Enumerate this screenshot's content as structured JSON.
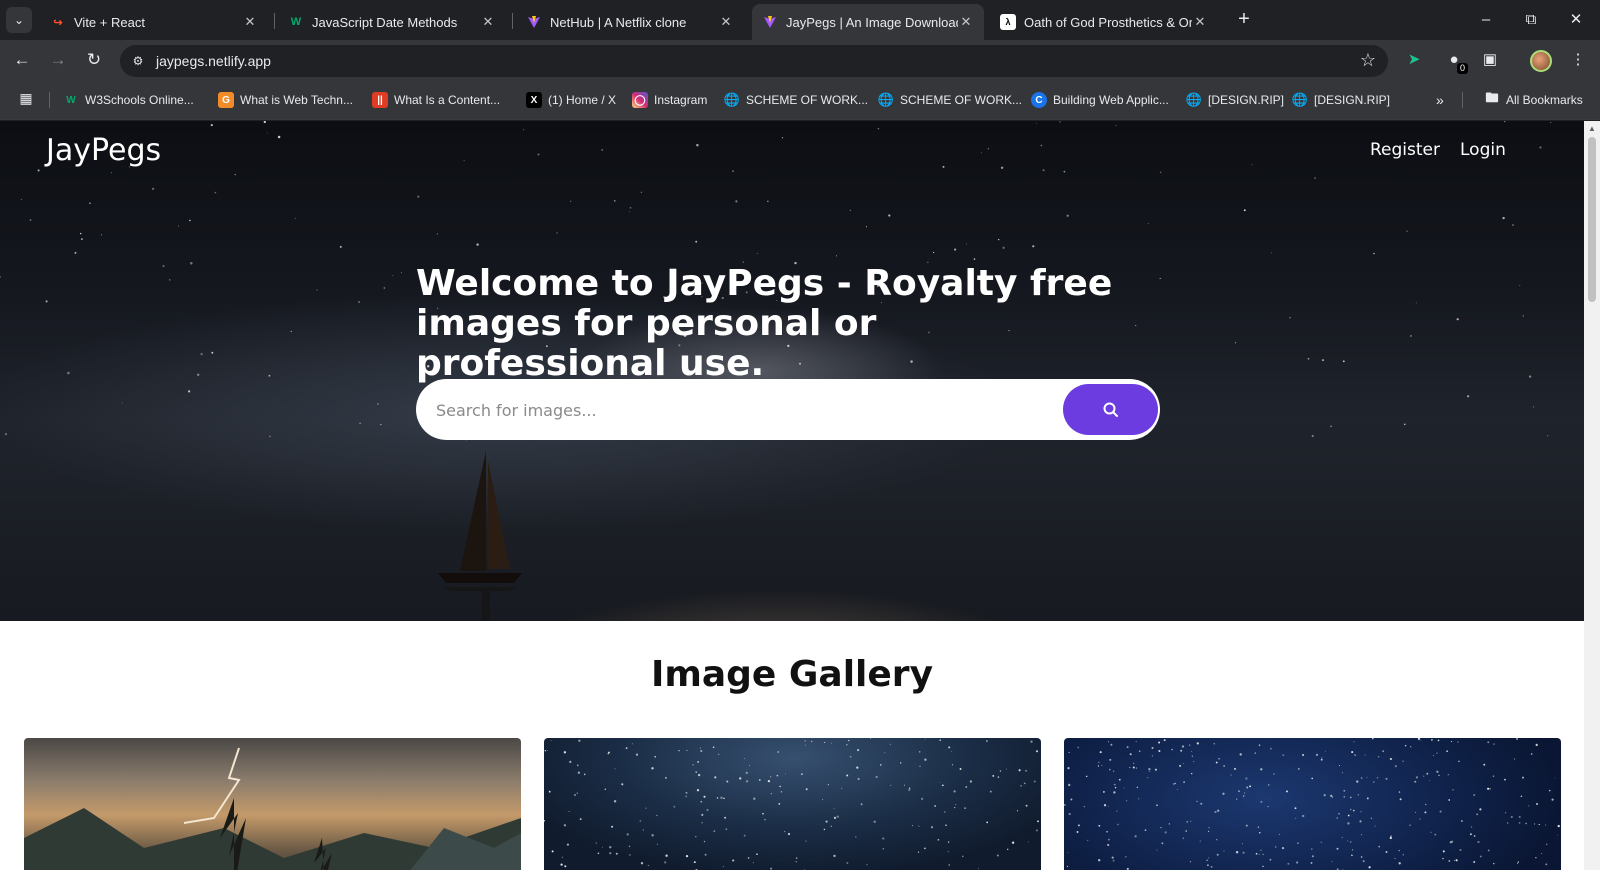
{
  "browser": {
    "tabs": [
      {
        "label": "Vite + React",
        "icon": "vite-favicon",
        "active": false
      },
      {
        "label": "JavaScript Date Methods",
        "icon": "w3schools-favicon",
        "active": false
      },
      {
        "label": "NetHub | A Netflix clone",
        "icon": "vite-favicon",
        "active": false
      },
      {
        "label": "JayPegs | An Image Downloadin",
        "icon": "vite-favicon",
        "active": true
      },
      {
        "label": "Oath of God Prosthetics & Orth",
        "icon": "page-favicon",
        "active": false
      }
    ],
    "url": "jaypegs.netlify.app",
    "extension_badge": "0",
    "bookmarks": [
      {
        "label": "W3Schools Online...",
        "icon": "w3schools-favicon",
        "color": "#04aa6d"
      },
      {
        "label": "What is Web Techn...",
        "icon": "geeks-favicon",
        "color": "#f28c28"
      },
      {
        "label": "What Is a Content...",
        "icon": "bar-favicon",
        "color": "#e03b24"
      },
      {
        "label": "(1) Home / X",
        "icon": "x-favicon",
        "color": "#000000"
      },
      {
        "label": "Instagram",
        "icon": "instagram-favicon",
        "color": "#d62976"
      },
      {
        "label": "SCHEME OF WORK...",
        "icon": "globe-favicon",
        "color": "#9aa0a6"
      },
      {
        "label": "SCHEME OF WORK...",
        "icon": "globe-favicon",
        "color": "#9aa0a6"
      },
      {
        "label": "Building Web Applic...",
        "icon": "c-favicon",
        "color": "#1a73e8"
      },
      {
        "label": "[DESIGN.RIP]",
        "icon": "globe-favicon",
        "color": "#9aa0a6"
      },
      {
        "label": "[DESIGN.RIP]",
        "icon": "globe-favicon",
        "color": "#9aa0a6"
      }
    ],
    "all_bookmarks_label": "All Bookmarks"
  },
  "page": {
    "brand": "JayPegs",
    "nav": {
      "register": "Register",
      "login": "Login"
    },
    "hero_title": "Welcome to JayPegs - Royalty free images for personal or professional use.",
    "search_placeholder": "Search for images...",
    "accent_color": "#6c3ce1",
    "gallery_title": "Image Gallery"
  }
}
